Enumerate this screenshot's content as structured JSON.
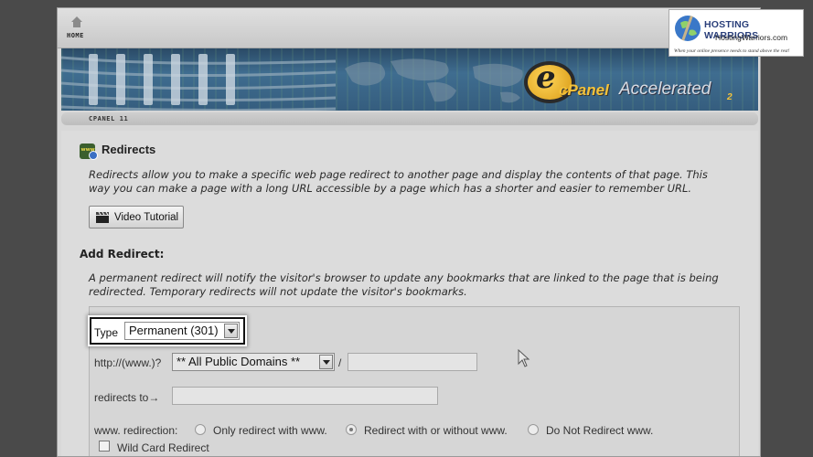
{
  "topbar": {
    "home_label": "HOME"
  },
  "banner": {
    "logo_e": "e",
    "logo_cpanel": "cPanel",
    "logo_accelerated": "Accelerated",
    "logo_version": "2"
  },
  "subbar": {
    "label": "CPANEL 11"
  },
  "page": {
    "title": "Redirects",
    "description": "Redirects allow you to make a specific web page redirect to another page and display the contents of that page. This way you can make a page with a long URL accessible by a page which has a shorter and easier to remember URL.",
    "video_button": "Video Tutorial",
    "section_title": "Add Redirect:",
    "section_description": "A permanent redirect will notify the visitor's browser to update any bookmarks that are linked to the page that is being redirected. Temporary redirects will not update the visitor's bookmarks."
  },
  "form": {
    "type_label": "Type",
    "type_value": "Permanent (301)",
    "domain_prefix": "http://(www.)?",
    "domain_value": "** All Public Domains **",
    "path_separator": "/",
    "redirects_to_label": "redirects to→",
    "www_label": "www. redirection:",
    "www_options": [
      {
        "label": "Only redirect with www.",
        "selected": false
      },
      {
        "label": "Redirect with or without www.",
        "selected": true
      },
      {
        "label": "Do Not Redirect www.",
        "selected": false
      }
    ],
    "wildcard_label": "Wild Card Redirect"
  },
  "watermark": {
    "name": "HOSTING WARRIORS",
    "url": "HostingWarriors.com",
    "tagline": "When your online presence needs to stand above the rest!"
  },
  "colors": {
    "banner_blue": "#3f6d90",
    "cpanel_gold": "#f4c23a",
    "highlight_border": "#111111"
  }
}
